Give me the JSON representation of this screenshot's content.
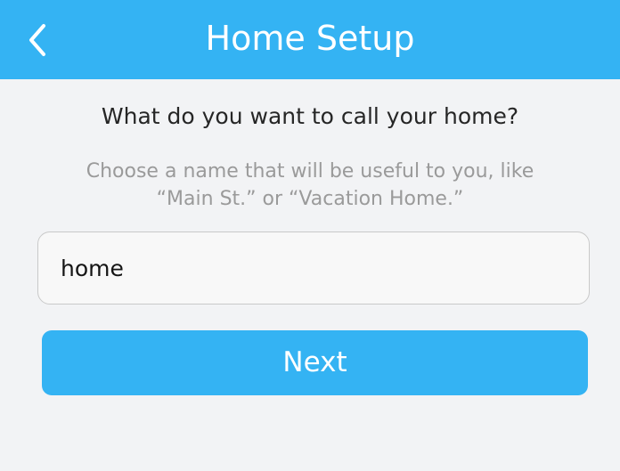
{
  "header": {
    "title": "Home Setup",
    "back_icon": "chevron-left-icon",
    "background_color": "#34b3f3"
  },
  "content": {
    "question": "What do you want to call your home?",
    "helper_line_1": "Choose a name that will be useful to you, like",
    "helper_line_2": "“Main St.” or “Vacation Home.”"
  },
  "home_name_input": {
    "value": "home",
    "placeholder": ""
  },
  "actions": {
    "next_label": "Next",
    "next_color": "#34b3f3"
  }
}
